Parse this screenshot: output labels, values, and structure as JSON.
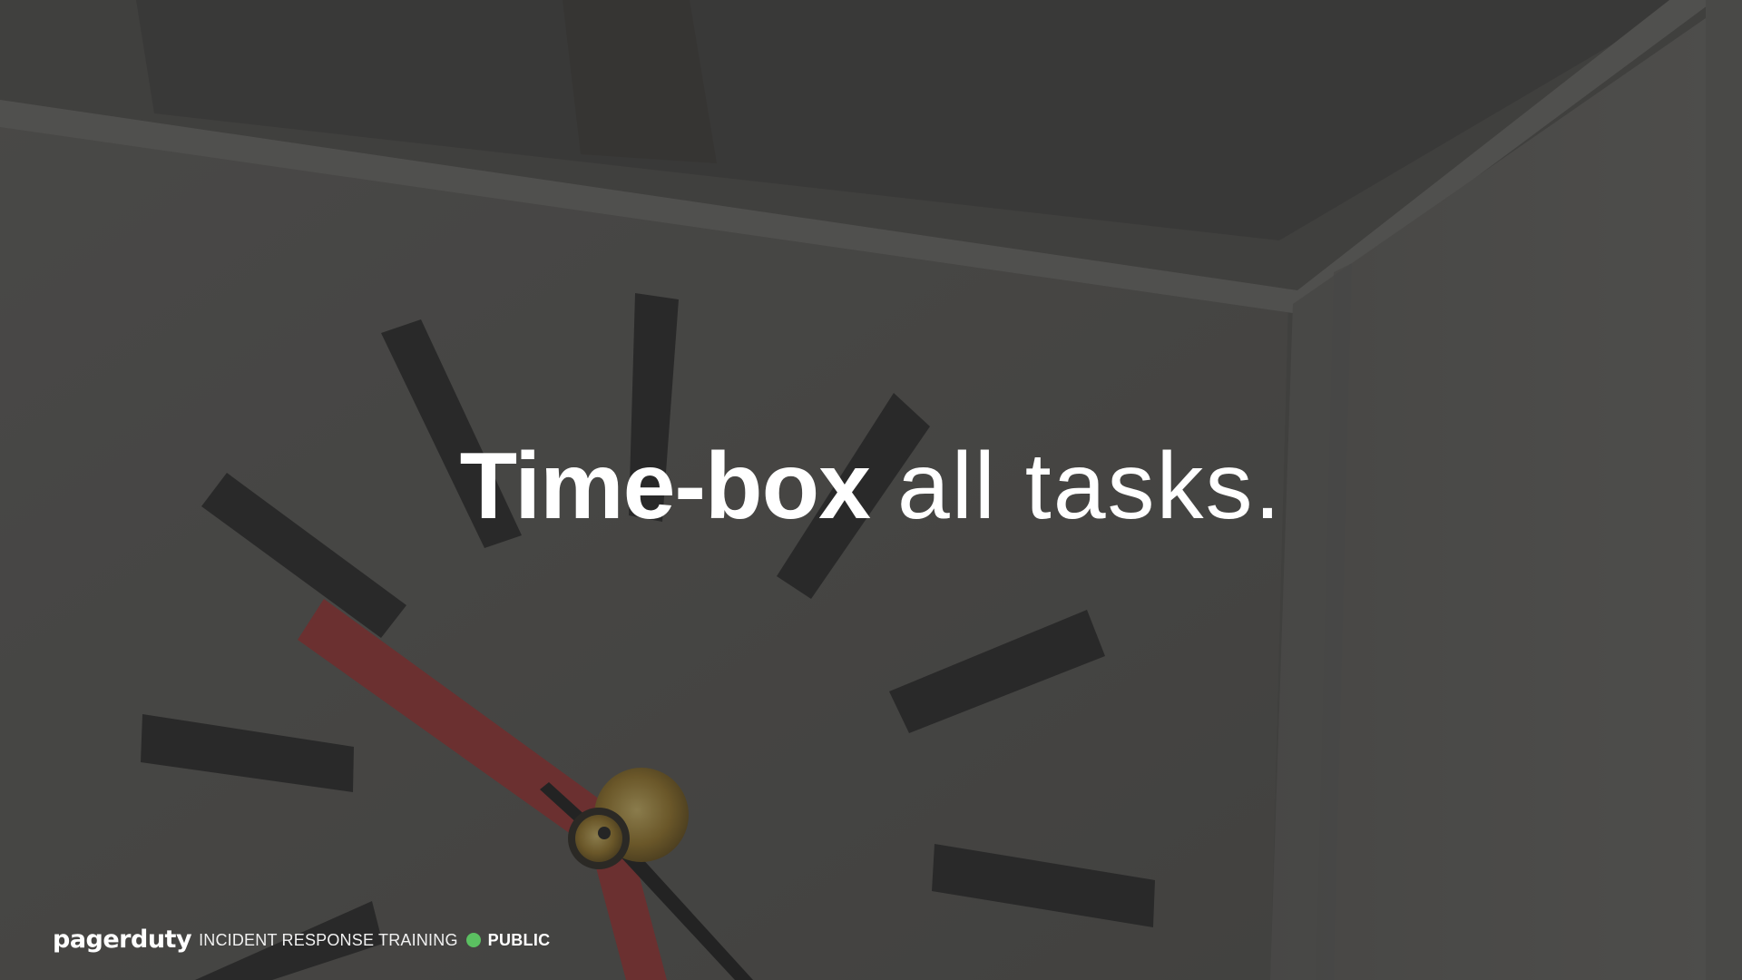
{
  "slide": {
    "headline": {
      "emphasis": "Time-box",
      "rest": "all tasks."
    },
    "background_image": "wall-clock-close-up"
  },
  "footer": {
    "brand": "pagerduty",
    "course": "INCIDENT RESPONSE TRAINING",
    "classification": "PUBLIC",
    "status_icon": "green-dot-icon"
  },
  "colors": {
    "text": "#ffffff",
    "status_green": "#5bc061",
    "clock_hand_red": "#b33a3a"
  }
}
